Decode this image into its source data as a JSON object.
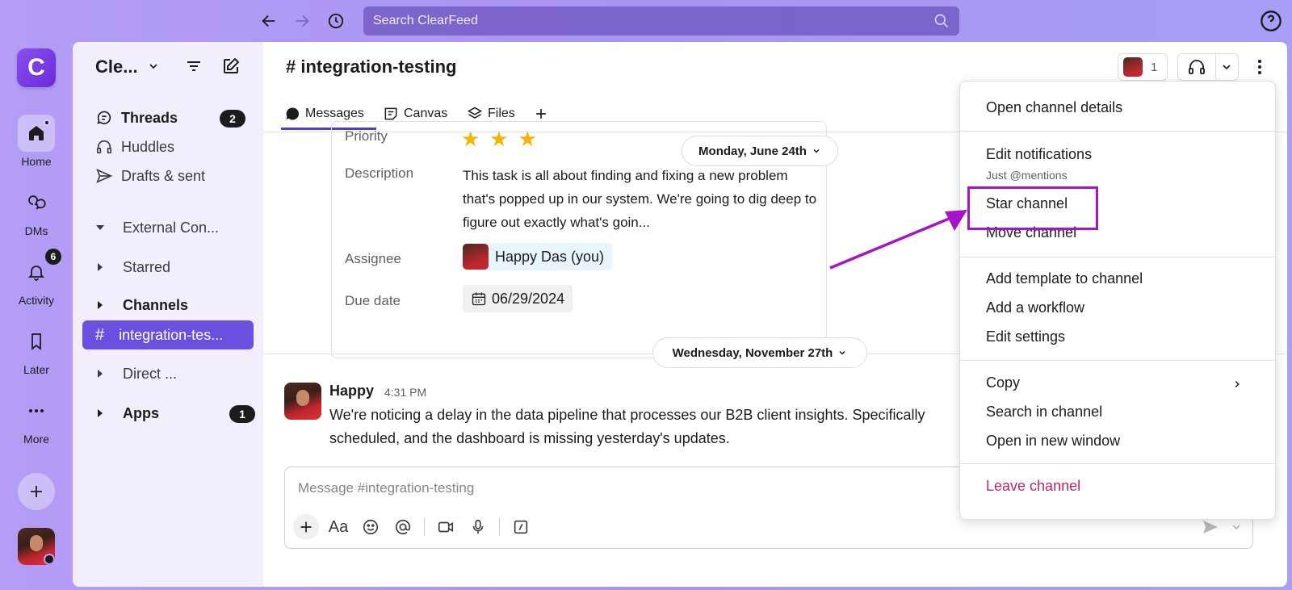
{
  "topbar": {
    "search_placeholder": "Search ClearFeed"
  },
  "rail": {
    "logo_letter": "C",
    "items": [
      {
        "label": "Home"
      },
      {
        "label": "DMs"
      },
      {
        "label": "Activity",
        "badge": "6"
      },
      {
        "label": "Later"
      },
      {
        "label": "More"
      }
    ]
  },
  "sidebar": {
    "workspace_name": "Cle...",
    "threads": {
      "label": "Threads",
      "count": "2"
    },
    "huddles": "Huddles",
    "drafts": "Drafts & sent",
    "sections": {
      "external": "External Con...",
      "starred": "Starred",
      "channels": "Channels",
      "active_channel": "integration-tes...",
      "direct": "Direct ...",
      "apps": {
        "label": "Apps",
        "count": "1"
      }
    }
  },
  "channel": {
    "title": "# integration-testing",
    "member_count": "1",
    "tabs": [
      {
        "label": "Messages"
      },
      {
        "label": "Canvas"
      },
      {
        "label": "Files"
      }
    ]
  },
  "card": {
    "priority_label": "Priority",
    "stars": "★★★",
    "description_label": "Description",
    "description": "This task is all about finding and fixing a new problem that's popped up in our system. We're going to dig deep to figure out exactly what's goin...",
    "assignee_label": "Assignee",
    "assignee": "Happy Das (you)",
    "due_label": "Due date",
    "due_date": "06/29/2024"
  },
  "dates": {
    "first": "Monday, June 24th",
    "second": "Wednesday, November 27th"
  },
  "message": {
    "author": "Happy",
    "time": "4:31 PM",
    "line1": "We're noticing a delay in the data pipeline that processes our B2B client insights. Specifically",
    "line2": "scheduled, and the dashboard is missing yesterday's updates."
  },
  "composer": {
    "placeholder": "Message #integration-testing"
  },
  "menu": {
    "open_details": "Open channel details",
    "edit_notifications": "Edit notifications",
    "notifications_sub": "Just @mentions",
    "star": "Star channel",
    "move": "Move channel",
    "add_template": "Add template to channel",
    "add_workflow": "Add a workflow",
    "edit_settings": "Edit settings",
    "copy": "Copy",
    "search": "Search in channel",
    "open_window": "Open in new window",
    "leave": "Leave channel"
  },
  "colors": {
    "accent": "#6a4fe0",
    "highlight": "#a414c8",
    "danger": "#c0245f"
  }
}
